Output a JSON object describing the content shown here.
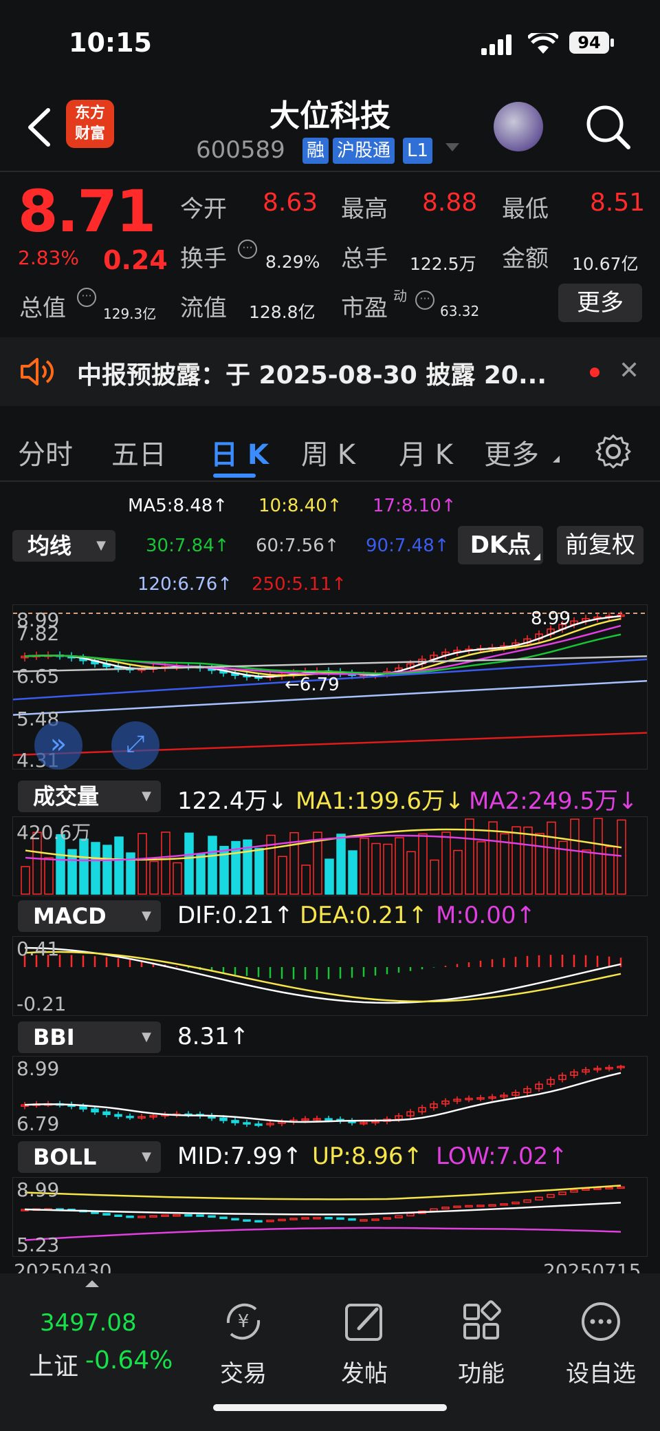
{
  "status": {
    "time": "10:15",
    "battery": "94"
  },
  "header": {
    "logo_line1": "东方",
    "logo_line2": "财富",
    "name": "大位科技",
    "code": "600589",
    "tags": [
      "融",
      "沪股通",
      "L1"
    ]
  },
  "quote": {
    "price": "8.71",
    "change_pct": "2.83%",
    "change_amt": "0.24",
    "fields": {
      "open_label": "今开",
      "open": "8.63",
      "high_label": "最高",
      "high": "8.88",
      "low_label": "最低",
      "low": "8.51",
      "turnover_label": "换手",
      "turnover": "8.29%",
      "volume_label": "总手",
      "volume": "122.5万",
      "amount_label": "金额",
      "amount": "10.67亿",
      "mktcap_label": "总值",
      "mktcap": "129.3亿",
      "float_label": "流值",
      "float": "128.8亿",
      "pe_label": "市盈",
      "pe_sup": "动",
      "pe": "63.32"
    },
    "more_button": "更多"
  },
  "notice": {
    "text": "中报预披露：于 2025-08-30 披露 20..."
  },
  "tabs": {
    "items": [
      "分时",
      "五日",
      "日 K",
      "周 K",
      "月 K",
      "更多"
    ],
    "active": "日 K"
  },
  "ma_panel": {
    "selector": "均线",
    "ma5": "MA5:8.48↑",
    "ma10": "10:8.40↑",
    "ma17": "17:8.10↑",
    "ma30": "30:7.84↑",
    "ma60": "60:7.56↑",
    "ma90": "90:7.48↑",
    "ma120": "120:6.76↑",
    "ma250": "250:5.11↑",
    "dk_button": "DK点",
    "adjust_button": "前复权"
  },
  "main_chart": {
    "y_labels": [
      "8.99",
      "7.82",
      "6.65",
      "5.48",
      "4.31"
    ],
    "high_marker": "8.99",
    "low_marker": "←6.79",
    "colors": {
      "up": "#ff2a2a",
      "down": "#18d9e0",
      "ma5": "#ffffff",
      "ma10": "#f7e64b",
      "ma17": "#e040e0",
      "ma30": "#19c437",
      "ma60": "#c8c8c8",
      "ma90": "#3a5df0",
      "ma120": "#a9c2ff",
      "ma250": "#e01b1b"
    }
  },
  "volume_panel": {
    "selector": "成交量",
    "value": "122.4万↓",
    "ma1": "MA1:199.6万↓",
    "ma2": "MA2:249.5万↓",
    "y_label": "420.6万"
  },
  "macd_panel": {
    "selector": "MACD",
    "dif": "DIF:0.21↑",
    "dea": "DEA:0.21↑",
    "m": "M:0.00↑",
    "y_top": "0.41",
    "y_bottom": "-0.21"
  },
  "bbi_panel": {
    "selector": "BBI",
    "value": "8.31↑",
    "y_top": "8.99",
    "y_bottom": "6.79"
  },
  "boll_panel": {
    "selector": "BOLL",
    "mid": "MID:7.99↑",
    "up": "UP:8.96↑",
    "low": "LOW:7.02↑",
    "y_top": "8.99",
    "y_bottom": "5.23",
    "date_start": "20250430",
    "date_end": "20250715"
  },
  "bottom_nav": {
    "index_value": "3497.08",
    "index_name": "上证",
    "index_change": "-0.64%",
    "items": [
      "交易",
      "发帖",
      "功能",
      "设自选"
    ]
  }
}
